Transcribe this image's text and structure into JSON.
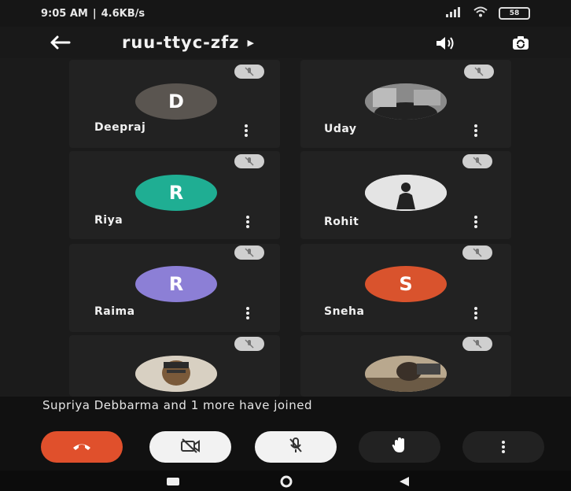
{
  "status": {
    "time": "9:05 AM",
    "speed": "4.6KB/s",
    "battery": "58"
  },
  "header": {
    "title": "ruu-ttyc-zfz"
  },
  "participants": [
    {
      "name": "Deepraj",
      "initial": "D",
      "color": "#5a5550"
    },
    {
      "name": "Uday",
      "initial": "",
      "color": "#6e6e6e"
    },
    {
      "name": "Riya",
      "initial": "R",
      "color": "#1fae93"
    },
    {
      "name": "Rohit",
      "initial": "",
      "color": "#d9d9d9"
    },
    {
      "name": "Raima",
      "initial": "R",
      "color": "#8c7fd6"
    },
    {
      "name": "Sneha",
      "initial": "S",
      "color": "#d9532d"
    },
    {
      "name": "",
      "initial": "",
      "color": "#9a8f80"
    },
    {
      "name": "",
      "initial": "",
      "color": "#8a7a66"
    }
  ],
  "notification": "Supriya Debbarma and 1 more have joined",
  "colors": {
    "end_call": "#e0502c",
    "control_light": "#f2f2f2",
    "control_dark": "#222222"
  },
  "icons": [
    "back-arrow-icon",
    "play-arrow-icon",
    "speaker-icon",
    "camera-switch-icon",
    "mic-off-icon",
    "more-vert-icon",
    "end-call-icon",
    "camera-off-icon",
    "mic-off-icon",
    "raise-hand-icon",
    "nav-recents-icon",
    "nav-home-icon",
    "nav-back-icon"
  ]
}
